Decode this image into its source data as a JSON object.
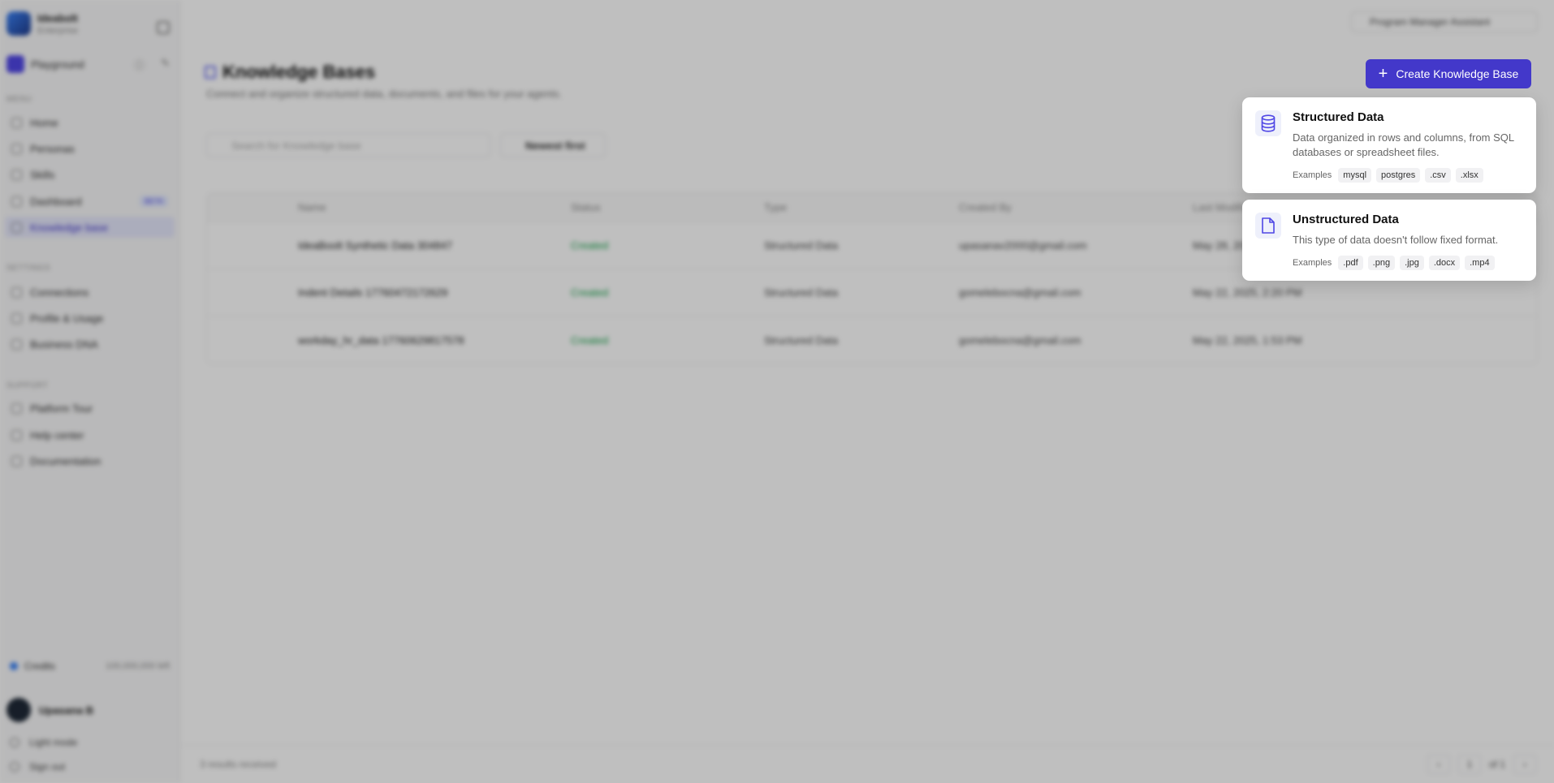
{
  "sidebar": {
    "brand_name": "Ideabolt",
    "brand_sub": "Enterprise",
    "playground_label": "Playground",
    "menu_label": "MENU",
    "menu_items": [
      "Home",
      "Personas",
      "Skills",
      "Dashboard",
      "Knowledge base"
    ],
    "beta_label": "BETA",
    "settings_label": "SETTINGS",
    "settings_items": [
      "Connections",
      "Profile & Usage",
      "Business DNA"
    ],
    "support_label": "SUPPORT",
    "support_items": [
      "Platform Tour",
      "Help center",
      "Documentation"
    ],
    "credits_label": "Credits",
    "credits_value": "100,000,000 left",
    "user_name": "Upasana B",
    "light_mode": "Light mode",
    "sign_out": "Sign out"
  },
  "topbar": {
    "agent_select": "Program Manager Assistant"
  },
  "page": {
    "title": "Knowledge Bases",
    "subtitle": "Connect and organize structured data, documents, and files for your agents.",
    "search_placeholder": "Search for Knowledge base",
    "sort_label": "Newest first",
    "create_button": "Create Knowledge Base"
  },
  "table": {
    "headers": [
      "Name",
      "Status",
      "Type",
      "Created By",
      "Last Modified"
    ],
    "rows": [
      {
        "name": "IdeaBoolt Synthetic Data 304847",
        "status": "Created",
        "type": "Structured Data",
        "created_by": "upasanav2000@gmail.com",
        "modified": "May 28, 2025"
      },
      {
        "name": "Indent Details 17760472172629",
        "status": "Created",
        "type": "Structured Data",
        "created_by": "gomelebocna@gmail.com",
        "modified": "May 22, 2025, 2:20 PM"
      },
      {
        "name": "workday_hr_data 17760629817578",
        "status": "Created",
        "type": "Structured Data",
        "created_by": "gomelebocna@gmail.com",
        "modified": "May 22, 2025, 1:53 PM"
      }
    ]
  },
  "footer": {
    "results": "3 results received",
    "page": "1",
    "of_pages": "of 1"
  },
  "dropdown": {
    "structured": {
      "title": "Structured Data",
      "description": "Data organized in rows and columns, from SQL databases or spreadsheet files.",
      "examples_label": "Examples",
      "examples": [
        "mysql",
        "postgres",
        ".csv",
        ".xlsx"
      ]
    },
    "unstructured": {
      "title": "Unstructured Data",
      "description": "This type of data doesn't follow fixed format.",
      "examples_label": "Examples",
      "examples": [
        ".pdf",
        ".png",
        ".jpg",
        ".docx",
        ".mp4"
      ]
    }
  },
  "colors": {
    "accent": "#4338ca",
    "icon_accent": "#4f46e5"
  }
}
